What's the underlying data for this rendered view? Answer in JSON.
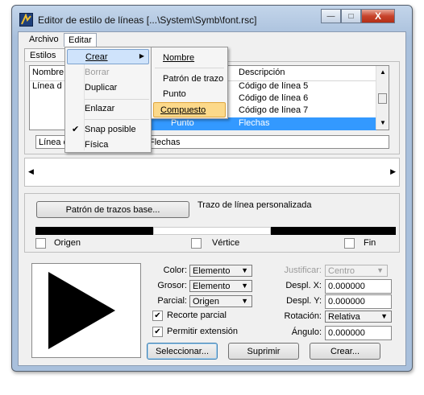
{
  "window": {
    "title": "Editor de estilo de líneas [...\\System\\Symb\\font.rsc]",
    "minimize_glyph": "—",
    "maximize_glyph": "□",
    "close_glyph": "X"
  },
  "menubar": {
    "archivo": "Archivo",
    "editar": "Editar"
  },
  "tabs": {
    "estilos": "Estilos"
  },
  "styles_list": {
    "col_nombre": "Nombre",
    "row_visible": "Línea d"
  },
  "components_list": {
    "col_descripcion": "Descripción",
    "rows": [
      {
        "descripcion": "Código de línea 5"
      },
      {
        "descripcion": "Código de línea 6"
      },
      {
        "descripcion": "Código de línea 7"
      },
      {
        "tipo": "Punto",
        "descripcion": "Flechas"
      }
    ]
  },
  "name_field": "Línea d",
  "desc_field": "Flechas",
  "dash": {
    "base_button": "Patrón de trazos base...",
    "custom_label": "Trazo de línea personalizada",
    "origen": "Origen",
    "vertice": "Vértice",
    "fin": "Fin"
  },
  "props": {
    "color_label": "Color:",
    "color_value": "Elemento",
    "grosor_label": "Grosor:",
    "grosor_value": "Elemento",
    "parcial_label": "Parcial:",
    "parcial_value": "Origen",
    "recorte": "Recorte parcial",
    "permitir": "Permitir extensión",
    "justificar_label": "Justificar:",
    "justificar_value": "Centro",
    "despl_x_label": "Despl. X:",
    "despl_x_value": "0.000000",
    "despl_y_label": "Despl. Y:",
    "despl_y_value": "0.000000",
    "rotacion_label": "Rotación:",
    "rotacion_value": "Relativa",
    "angulo_label": "Ángulo:",
    "angulo_value": "0.000000"
  },
  "buttons": {
    "seleccionar": "Seleccionar...",
    "suprimir": "Suprimir",
    "crear": "Crear..."
  },
  "editar_menu": {
    "crear": "Crear",
    "borrar": "Borrar",
    "duplicar": "Duplicar",
    "enlazar": "Enlazar",
    "snap": "Snap posible",
    "fisica": "Física"
  },
  "crear_submenu": {
    "nombre": "Nombre",
    "patron": "Patrón de trazo",
    "punto": "Punto",
    "compuesto": "Compuesto"
  },
  "colors": {
    "highlight": "#3399ff",
    "menu_hover": "#cfe3fb",
    "compuesto_box": "#fcd98a"
  }
}
